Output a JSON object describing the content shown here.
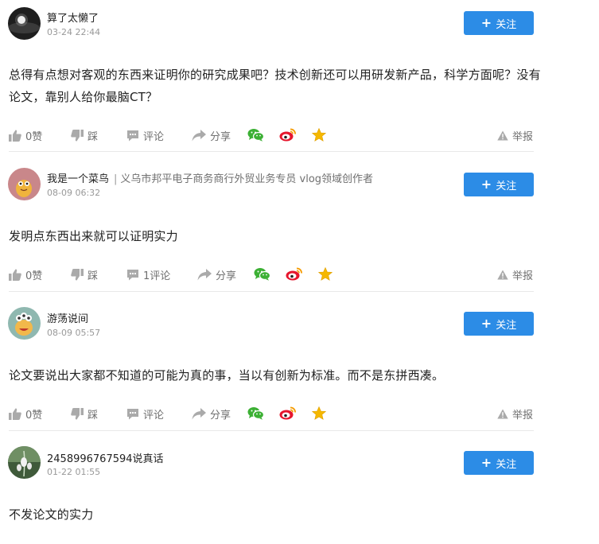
{
  "icons": {
    "like": "thumbs-up-icon",
    "dislike": "thumbs-down-icon",
    "comment": "comment-icon",
    "share": "share-icon",
    "wechat": "wechat-icon",
    "weibo": "weibo-icon",
    "favorite": "star-icon",
    "report": "warning-icon"
  },
  "colors": {
    "follow_button": "#2c8ce6",
    "wechat": "#3cb034",
    "weibo": "#e6162d",
    "star": "#f5b800",
    "icon_gray": "#aaaaaa"
  },
  "comments": [
    {
      "username": "算了太懒了",
      "user_desc": "",
      "time": "03-24 22:44",
      "follow_label": "关注",
      "text": "总得有点想对客观的东西来证明你的研究成果吧？技术创新还可以用研发新产品，科学方面呢？没有论文，靠别人给你最脑CT？",
      "like_label": "0赞",
      "dislike_label": "踩",
      "comment_label": "评论",
      "share_label": "分享",
      "report_label": "举报"
    },
    {
      "username": "我是一个菜鸟",
      "user_desc": "义乌市邦平电子商务商行外贸业务专员 vlog领域创作者",
      "time": "08-09 06:32",
      "follow_label": "关注",
      "text": "发明点东西出来就可以证明实力",
      "like_label": "0赞",
      "dislike_label": "踩",
      "comment_label": "1评论",
      "share_label": "分享",
      "report_label": "举报"
    },
    {
      "username": "游荡说间",
      "user_desc": "",
      "time": "08-09 05:57",
      "follow_label": "关注",
      "text": "论文要说出大家都不知道的可能为真的事，当以有创新为标准。而不是东拼西凑。",
      "like_label": "0赞",
      "dislike_label": "踩",
      "comment_label": "评论",
      "share_label": "分享",
      "report_label": "举报"
    },
    {
      "username": "2458996767594说真话",
      "user_desc": "",
      "time": "01-22 01:55",
      "follow_label": "关注",
      "text": "不发论文的实力"
    }
  ]
}
